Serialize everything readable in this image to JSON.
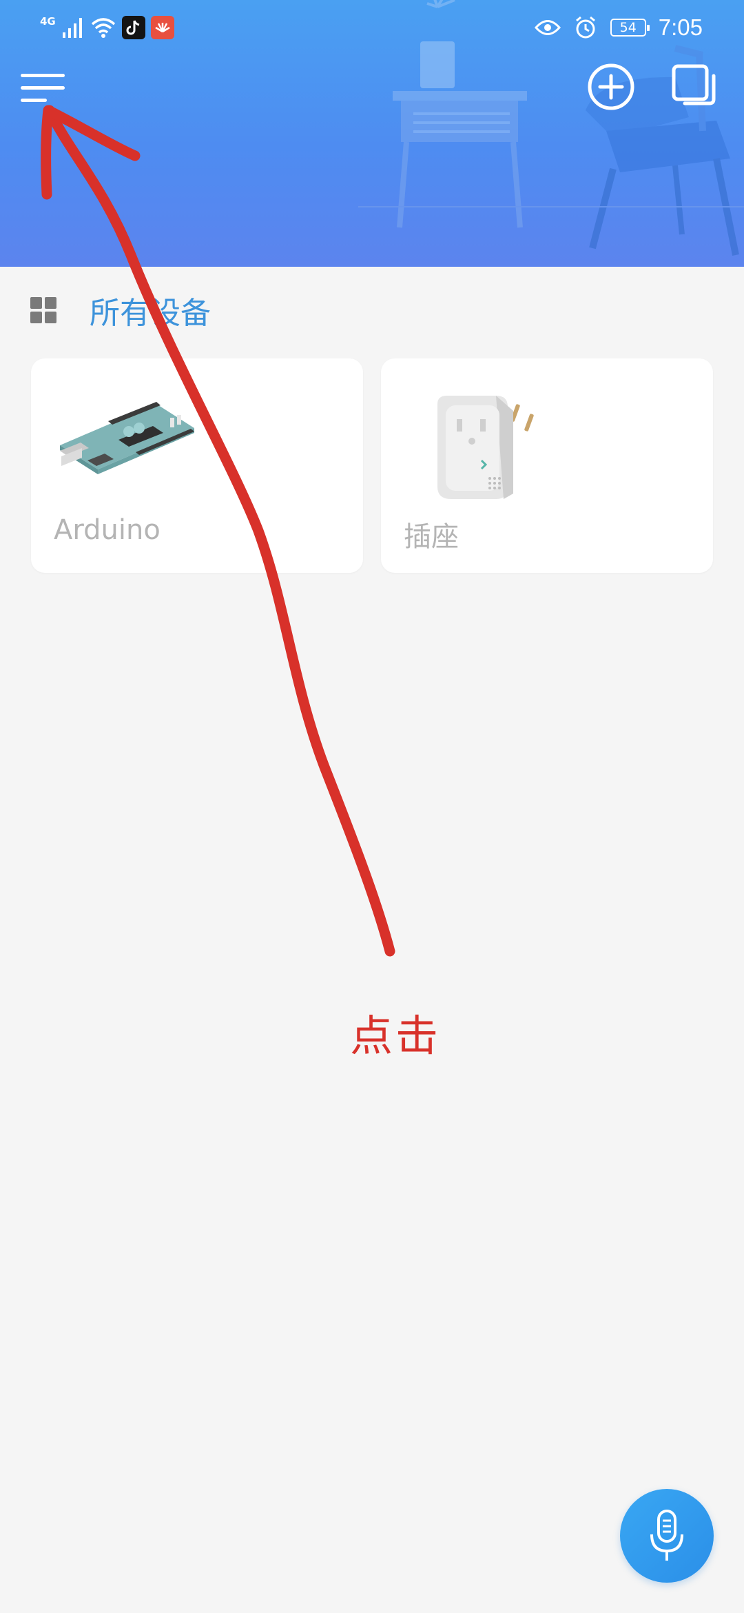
{
  "status_bar": {
    "network": "4G",
    "battery": "54",
    "time": "7:05",
    "icons": [
      "signal-icon",
      "wifi-icon",
      "tiktok-icon",
      "huawei-icon",
      "eye-icon",
      "alarm-icon",
      "battery-icon"
    ]
  },
  "header": {
    "menu_icon": "menu-icon",
    "add_icon": "add-circle-icon",
    "multi_icon": "multi-window-icon"
  },
  "section": {
    "title": "所有设备",
    "icon": "grid-icon"
  },
  "devices": [
    {
      "name": "Arduino",
      "icon": "arduino-board-image"
    },
    {
      "name": "插座",
      "icon": "smart-socket-image"
    }
  ],
  "annotation": {
    "label": "点击",
    "color": "#d8312a"
  },
  "voice_button": {
    "icon": "microphone-icon"
  },
  "colors": {
    "header_top": "#4aa0f2",
    "header_bottom": "#5c84ee",
    "accent": "#3d93db",
    "background": "#f5f5f5"
  }
}
